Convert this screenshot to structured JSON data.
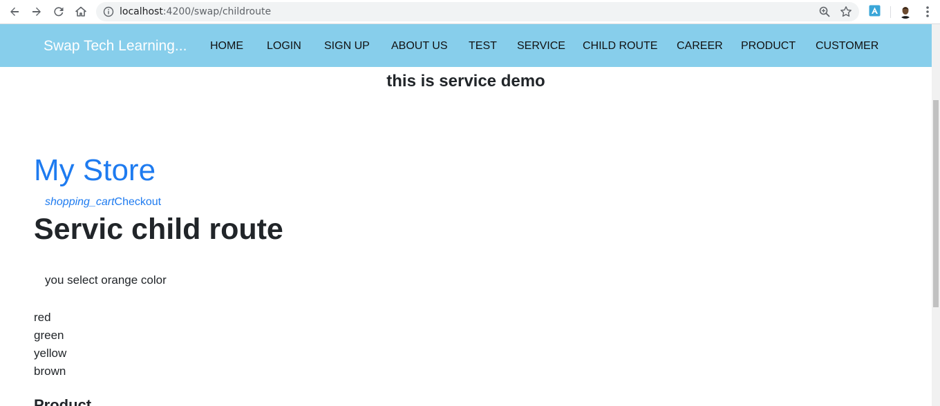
{
  "browser": {
    "url_host": "localhost",
    "url_path": ":4200/swap/childroute",
    "icons": {
      "back": "back-arrow-icon",
      "forward": "forward-arrow-icon",
      "reload": "reload-icon",
      "home": "home-icon",
      "info": "info-icon",
      "zoom": "zoom-icon",
      "bookmark": "star-icon",
      "extension": "extension-icon",
      "profile": "avatar",
      "menu": "more-vert-icon"
    }
  },
  "navbar": {
    "brand": "Swap Tech Learning...",
    "background": "#87ceeb",
    "links": [
      "HOME",
      "LOGIN",
      "SIGN UP",
      "ABOUT US",
      "TEST",
      "SERVICE",
      "CHILD ROUTE",
      "CAREER",
      "PRODUCT",
      "CUSTOMER"
    ]
  },
  "main": {
    "service_title": "this is service demo",
    "store_title": "My Store",
    "checkout_icon": "shopping_cart",
    "checkout_label": "Checkout",
    "child_title": "Servic child route",
    "selected_color": "you select orange color",
    "colors": [
      "red",
      "green",
      "yellow",
      "brown"
    ],
    "product_heading": "Product"
  },
  "colors": {
    "link": "#1e7bf0",
    "text": "#212529"
  }
}
